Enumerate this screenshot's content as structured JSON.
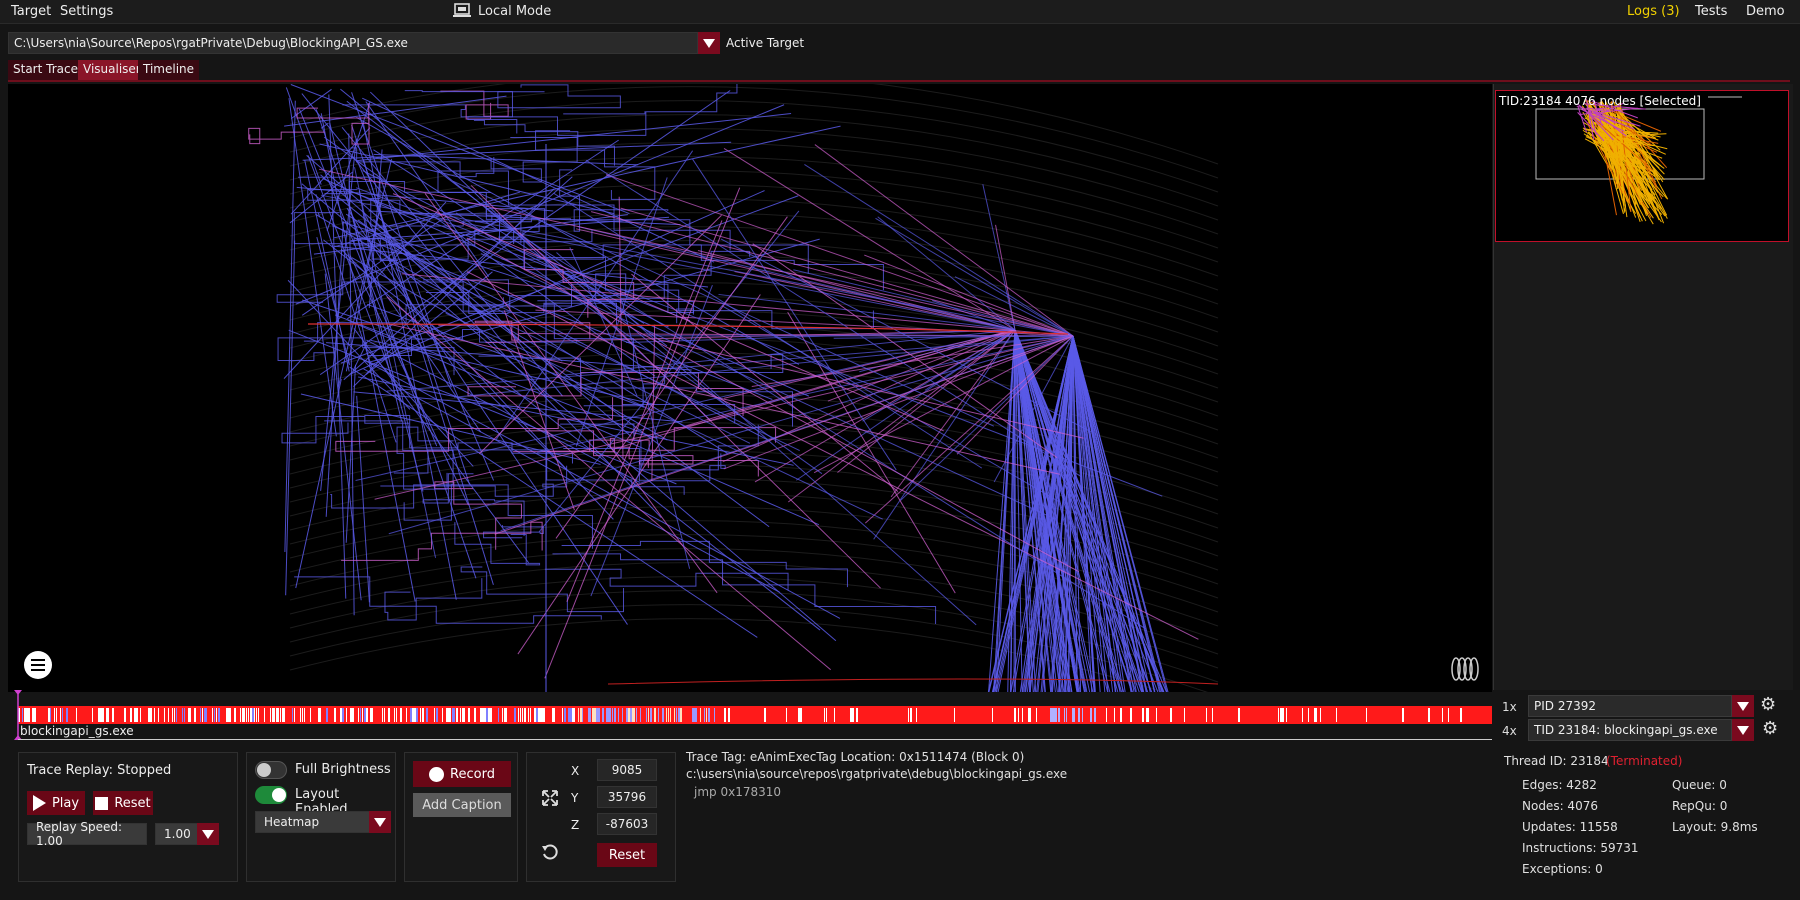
{
  "menubar": {
    "target": "Target",
    "settings": "Settings",
    "local_mode": "Local Mode",
    "logs": "Logs (3)",
    "tests": "Tests",
    "demo": "Demo"
  },
  "target": {
    "path": "C:\\Users\\nia\\Source\\Repos\\rgatPrivate\\Debug\\BlockingAPI_GS.exe",
    "active_label": "Active Target"
  },
  "tabs": [
    {
      "label": "Start Trace",
      "active": false
    },
    {
      "label": "Visualiser",
      "active": true
    },
    {
      "label": "Timeline",
      "active": false
    }
  ],
  "preview": {
    "label": "TID:23184 4076 nodes [Selected]"
  },
  "timeline": {
    "label": "blockingapi_gs.exe"
  },
  "selectors": {
    "pid_count": "1x",
    "pid_value": "PID 27392",
    "tid_count": "4x",
    "tid_value": "TID 23184: blockingapi_gs.exe"
  },
  "thread_info": {
    "thread_id": "Thread ID: 23184",
    "status": "(Terminated)",
    "edges": "Edges: 4282",
    "nodes": "Nodes: 4076",
    "updates": "Updates: 11558",
    "instructions": "Instructions: 59731",
    "exceptions": "Exceptions: 0",
    "queue": "Queue: 0",
    "repqu": "RepQu: 0",
    "layout": "Layout: 9.8ms"
  },
  "replay": {
    "status": "Trace Replay: Stopped",
    "play": "Play",
    "reset": "Reset",
    "speed_label": "Replay Speed: 1.00",
    "speed_value": "1.00"
  },
  "display": {
    "full_brightness": "Full Brightness",
    "full_brightness_on": false,
    "layout_enabled": "Layout Enabled",
    "layout_enabled_on": true,
    "mode": "Heatmap"
  },
  "record": {
    "record": "Record",
    "add_caption": "Add Caption"
  },
  "camera": {
    "x_label": "X",
    "x": "9085",
    "y_label": "Y",
    "y": "35796",
    "z_label": "Z",
    "z": "-87603",
    "reset": "Reset"
  },
  "trace_tag": {
    "line1": "Trace Tag: eAnimExecTag Location: 0x1511474 (Block 0)",
    "line2": "c:\\users\\nia\\source\\repos\\rgatprivate\\debug\\blockingapi_gs.exe",
    "line3": "jmp 0x178310"
  },
  "colors": {
    "accent": "#7a0a1e",
    "logs": "#f0d000",
    "terminated": "#e02030",
    "edge_blue": "#5a5ae8",
    "edge_pink": "#d060d0"
  }
}
